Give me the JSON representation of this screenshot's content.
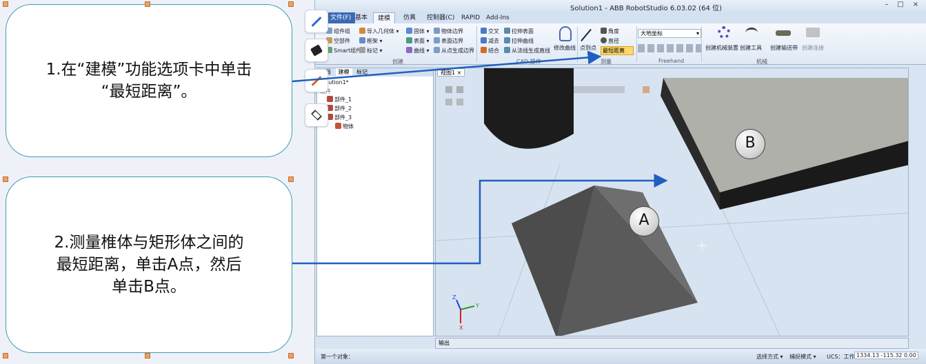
{
  "callouts": [
    {
      "lines": [
        "1.在“建模”功能选项卡中单击",
        "“最短距离”。"
      ]
    },
    {
      "lines": [
        "2.测量椎体与矩形体之间的",
        "最短距离，单击A点，然后",
        "单击B点。"
      ]
    }
  ],
  "tool_strip": [
    "pen-icon",
    "paint-bucket-icon",
    "pen-icon",
    "layers-icon"
  ],
  "app": {
    "title": "Solution1 - ABB RobotStudio 6.03.02 (64 位)",
    "tabs": [
      "文件(F)",
      "基本",
      "建模",
      "仿真",
      "控制器(C)",
      "RAPID",
      "Add-Ins"
    ],
    "active_tab": "建模",
    "ribbon": {
      "create": {
        "items": [
          "组件组",
          "空部件",
          "Smart组件",
          "导入几何体",
          "框架",
          "标记",
          "固体",
          "表面",
          "曲线",
          "物体边界",
          "表面边界",
          "从点生成边界"
        ],
        "label": "创建"
      },
      "cad": {
        "items": [
          "交叉",
          "减去",
          "结合",
          "拉伸表面",
          "拉伸曲线",
          "从法线生成直线",
          "修改曲线"
        ],
        "label": "CAD 操作"
      },
      "measure": {
        "items": [
          "点到点",
          "角度",
          "直径",
          "最短距离"
        ],
        "label": "测量"
      },
      "freehand": {
        "combo": "大地坐标",
        "label": "Freehand"
      },
      "mechanism": {
        "items": [
          "创建机械装置",
          "创建工具",
          "创建输送带",
          "创建连接"
        ],
        "label": "机械"
      }
    },
    "panel": {
      "tabs": [
        "布局",
        "建模",
        "标记"
      ],
      "tree": [
        "Solution1*",
        "组件",
        "部件_1",
        "部件_2",
        "部件_3",
        "物体"
      ]
    },
    "viewport_tab": "视图1",
    "labels": [
      "A",
      "B"
    ],
    "axes": [
      "X",
      "Y",
      "Z"
    ],
    "output_tab": "输出",
    "status": {
      "left": "第一个对象：",
      "mode": "选择方式",
      "snap": "捕捉模式",
      "ucs": "UCS：工作站",
      "coords": "1334.13 -115.32 0.00"
    }
  },
  "colors": {
    "arrow": "#1f5fc0",
    "callout_border": "#3d9bb5"
  }
}
